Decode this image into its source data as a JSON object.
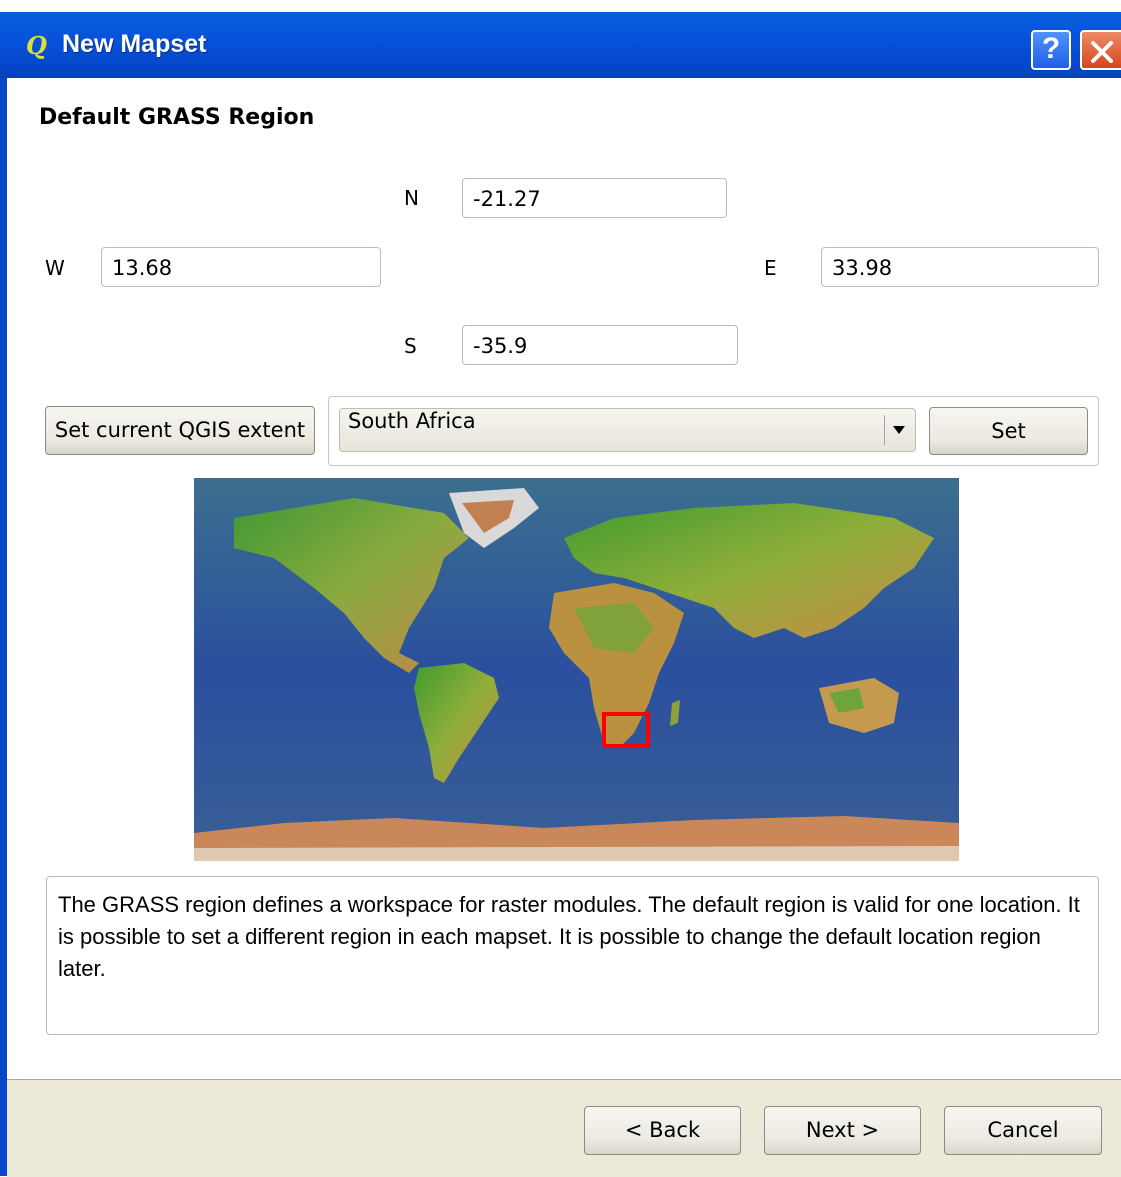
{
  "window": {
    "title": "New Mapset",
    "help_icon": "question-mark-icon",
    "close_icon": "close-x-icon",
    "help_label": "?"
  },
  "page": {
    "heading": "Default GRASS Region"
  },
  "region": {
    "n_label": "N",
    "n_value": "-21.27",
    "w_label": "W",
    "w_value": "13.68",
    "e_label": "E",
    "e_value": "33.98",
    "s_label": "S",
    "s_value": "-35.9"
  },
  "controls": {
    "set_extent_label": "Set current QGIS extent",
    "region_select_value": "South Africa",
    "set_label": "Set"
  },
  "map": {
    "description": "World relief map with selected region highlighted",
    "highlight_color": "#ff0000"
  },
  "info": {
    "text": "The GRASS region defines a workspace for raster modules. The default region is valid for one location. It is possible to set a different region in each mapset. It is possible to change the default location region later."
  },
  "footer": {
    "back_label": "< Back",
    "next_label": "Next >",
    "cancel_label": "Cancel"
  }
}
